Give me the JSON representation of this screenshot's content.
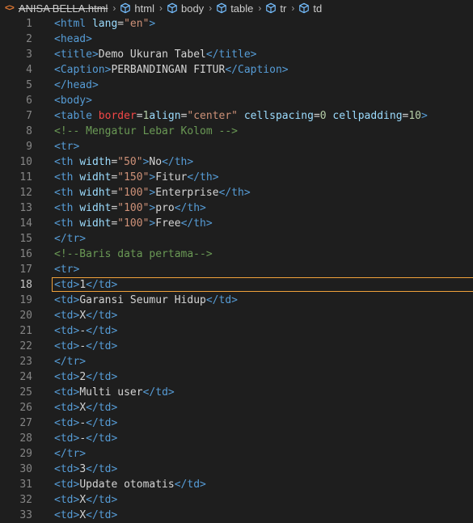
{
  "breadcrumb": {
    "file_icon": "<>",
    "file_name": "ANISA BELLA.html",
    "items": [
      "html",
      "body",
      "table",
      "tr",
      "td"
    ],
    "separator_icon": "chevron-right-icon",
    "element_icon": "cube-icon"
  },
  "editor": {
    "current_line": 18,
    "colors": {
      "tag": "#569cd6",
      "attr": "#9cdcfe",
      "string": "#ce9178",
      "number": "#b5cea8",
      "comment": "#6a9955",
      "text": "#d4d4d4",
      "line_number": "#858585",
      "current_line_border": "#f0a23b"
    },
    "lines": [
      {
        "n": "1",
        "tokens": [
          [
            "tag",
            "<html "
          ],
          [
            "attr",
            "lang"
          ],
          [
            "text",
            "="
          ],
          [
            "str",
            "\"en\""
          ],
          [
            "tag",
            ">"
          ]
        ]
      },
      {
        "n": "2",
        "tokens": [
          [
            "tag",
            "<head>"
          ]
        ]
      },
      {
        "n": "3",
        "tokens": [
          [
            "tag",
            "<title>"
          ],
          [
            "text",
            "Demo Ukuran Tabel"
          ],
          [
            "tag",
            "</title>"
          ]
        ]
      },
      {
        "n": "4",
        "tokens": [
          [
            "tag",
            "<Caption>"
          ],
          [
            "text",
            "PERBANDINGAN FITUR"
          ],
          [
            "tag",
            "</Caption>"
          ]
        ]
      },
      {
        "n": "5",
        "tokens": [
          [
            "tag",
            "</head>"
          ]
        ]
      },
      {
        "n": "6",
        "tokens": [
          [
            "tag",
            "<body>"
          ]
        ]
      },
      {
        "n": "7",
        "tokens": [
          [
            "tag",
            "<table "
          ],
          [
            "attrred",
            "border"
          ],
          [
            "text",
            "="
          ],
          [
            "num",
            "1"
          ],
          [
            "attr",
            "align"
          ],
          [
            "text",
            "="
          ],
          [
            "str",
            "\"center\""
          ],
          [
            "text",
            " "
          ],
          [
            "attr",
            "cellspacing"
          ],
          [
            "text",
            "="
          ],
          [
            "num",
            "0"
          ],
          [
            "text",
            " "
          ],
          [
            "attr",
            "cellpadding"
          ],
          [
            "text",
            "="
          ],
          [
            "num",
            "10"
          ],
          [
            "tag",
            ">"
          ]
        ]
      },
      {
        "n": "8",
        "tokens": [
          [
            "cmt",
            "<!-- Mengatur Lebar Kolom -->"
          ]
        ]
      },
      {
        "n": "9",
        "tokens": [
          [
            "tag",
            "<tr>"
          ]
        ]
      },
      {
        "n": "10",
        "tokens": [
          [
            "tag",
            "<th "
          ],
          [
            "attr",
            "width"
          ],
          [
            "text",
            "="
          ],
          [
            "str",
            "\"50\""
          ],
          [
            "tag",
            ">"
          ],
          [
            "text",
            "No"
          ],
          [
            "tag",
            "</th>"
          ]
        ]
      },
      {
        "n": "11",
        "tokens": [
          [
            "tag",
            "<th "
          ],
          [
            "attr",
            "widht"
          ],
          [
            "text",
            "="
          ],
          [
            "str",
            "\"150\""
          ],
          [
            "tag",
            ">"
          ],
          [
            "text",
            "Fitur"
          ],
          [
            "tag",
            "</th>"
          ]
        ]
      },
      {
        "n": "12",
        "tokens": [
          [
            "tag",
            "<th "
          ],
          [
            "attr",
            "widht"
          ],
          [
            "text",
            "="
          ],
          [
            "str",
            "\"100\""
          ],
          [
            "tag",
            ">"
          ],
          [
            "text",
            "Enterprise"
          ],
          [
            "tag",
            "</th>"
          ]
        ]
      },
      {
        "n": "13",
        "tokens": [
          [
            "tag",
            "<th "
          ],
          [
            "attr",
            "widht"
          ],
          [
            "text",
            "="
          ],
          [
            "str",
            "\"100\""
          ],
          [
            "tag",
            ">"
          ],
          [
            "text",
            "pro"
          ],
          [
            "tag",
            "</th>"
          ]
        ]
      },
      {
        "n": "14",
        "tokens": [
          [
            "tag",
            "<th "
          ],
          [
            "attr",
            "widht"
          ],
          [
            "text",
            "="
          ],
          [
            "str",
            "\"100\""
          ],
          [
            "tag",
            ">"
          ],
          [
            "text",
            "Free"
          ],
          [
            "tag",
            "</th>"
          ]
        ]
      },
      {
        "n": "15",
        "tokens": [
          [
            "tag",
            "</tr>"
          ]
        ]
      },
      {
        "n": "16",
        "tokens": [
          [
            "cmt",
            "<!--Baris data pertama-->"
          ]
        ]
      },
      {
        "n": "17",
        "tokens": [
          [
            "tag",
            "<tr>"
          ]
        ]
      },
      {
        "n": "18",
        "tokens": [
          [
            "tag",
            "<td>"
          ],
          [
            "text",
            "1"
          ],
          [
            "tag",
            "</td>"
          ]
        ]
      },
      {
        "n": "19",
        "tokens": [
          [
            "tag",
            "<td>"
          ],
          [
            "text",
            "Garansi Seumur Hidup"
          ],
          [
            "tag",
            "</td>"
          ]
        ]
      },
      {
        "n": "20",
        "tokens": [
          [
            "tag",
            "<td>"
          ],
          [
            "text",
            "X"
          ],
          [
            "tag",
            "</td>"
          ]
        ]
      },
      {
        "n": "21",
        "tokens": [
          [
            "tag",
            "<td>"
          ],
          [
            "text",
            "-"
          ],
          [
            "tag",
            "</td>"
          ]
        ]
      },
      {
        "n": "22",
        "tokens": [
          [
            "tag",
            "<td>"
          ],
          [
            "text",
            "-"
          ],
          [
            "tag",
            "</td>"
          ]
        ]
      },
      {
        "n": "23",
        "tokens": [
          [
            "tag",
            "</tr>"
          ]
        ]
      },
      {
        "n": "24",
        "tokens": [
          [
            "tag",
            "<td>"
          ],
          [
            "text",
            "2"
          ],
          [
            "tag",
            "</td>"
          ]
        ]
      },
      {
        "n": "25",
        "tokens": [
          [
            "tag",
            "<td>"
          ],
          [
            "text",
            "Multi user"
          ],
          [
            "tag",
            "</td>"
          ]
        ]
      },
      {
        "n": "26",
        "tokens": [
          [
            "tag",
            "<td>"
          ],
          [
            "text",
            "X"
          ],
          [
            "tag",
            "</td>"
          ]
        ]
      },
      {
        "n": "27",
        "tokens": [
          [
            "tag",
            "<td>"
          ],
          [
            "text",
            "-"
          ],
          [
            "tag",
            "</td>"
          ]
        ]
      },
      {
        "n": "28",
        "tokens": [
          [
            "tag",
            "<td>"
          ],
          [
            "text",
            "-"
          ],
          [
            "tag",
            "</td>"
          ]
        ]
      },
      {
        "n": "29",
        "tokens": [
          [
            "tag",
            "</tr>"
          ]
        ]
      },
      {
        "n": "30",
        "tokens": [
          [
            "tag",
            "<td>"
          ],
          [
            "text",
            "3"
          ],
          [
            "tag",
            "</td>"
          ]
        ]
      },
      {
        "n": "31",
        "tokens": [
          [
            "tag",
            "<td>"
          ],
          [
            "text",
            "Update otomatis"
          ],
          [
            "tag",
            "</td>"
          ]
        ]
      },
      {
        "n": "32",
        "tokens": [
          [
            "tag",
            "<td>"
          ],
          [
            "text",
            "X"
          ],
          [
            "tag",
            "</td>"
          ]
        ]
      },
      {
        "n": "33",
        "tokens": [
          [
            "tag",
            "<td>"
          ],
          [
            "text",
            "X"
          ],
          [
            "tag",
            "</td>"
          ]
        ]
      }
    ]
  }
}
